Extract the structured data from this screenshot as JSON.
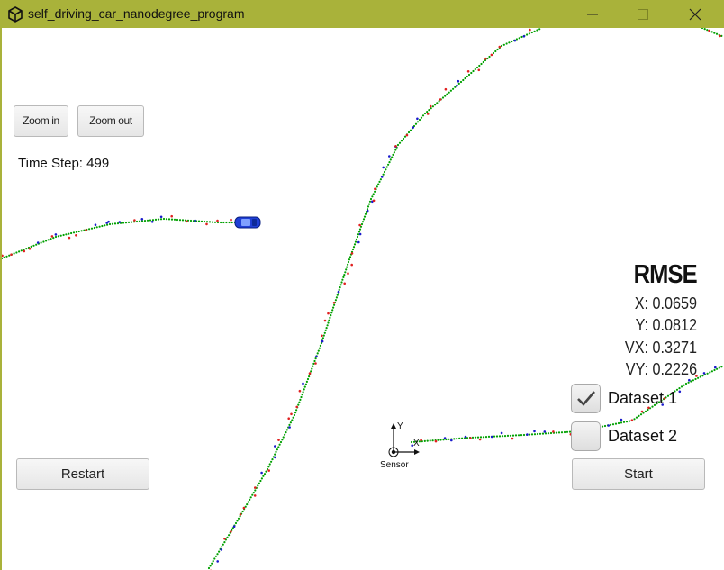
{
  "window": {
    "title": "self_driving_car_nanodegree_program",
    "buttons": [
      "minimize-icon",
      "maximize-icon",
      "close-icon"
    ],
    "frame_color": "#a9b23a"
  },
  "controls": {
    "zoom_in": "Zoom in",
    "zoom_out": "Zoom out",
    "restart": "Restart",
    "start": "Start"
  },
  "status": {
    "time_step": "Time Step: 499"
  },
  "rmse": {
    "title": "RMSE",
    "x": "X: 0.0659",
    "y": "Y: 0.0812",
    "vx": "VX: 0.3271",
    "vy": "VY: 0.2226"
  },
  "datasets": [
    {
      "label": "Dataset 1",
      "checked": true
    },
    {
      "label": "Dataset 2",
      "checked": false
    }
  ],
  "sensor": {
    "label": "Sensor",
    "axis_x": "X",
    "axis_y": "Y"
  },
  "colors": {
    "trajectory": "#00a000",
    "lidar": "#e02020",
    "radar": "#1a1acc",
    "car": "#1f3fd6"
  }
}
